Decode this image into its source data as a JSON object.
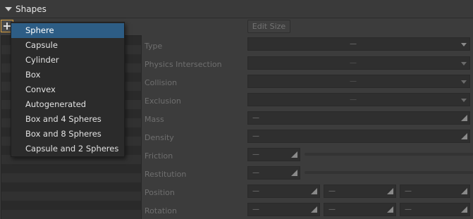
{
  "panel": {
    "title": "Shapes"
  },
  "toolbar": {
    "add_icon": "plus-icon",
    "edit_size_label": "Edit Size"
  },
  "menu": {
    "items": [
      {
        "label": "Sphere",
        "selected": true
      },
      {
        "label": "Capsule"
      },
      {
        "label": "Cylinder"
      },
      {
        "label": "Box"
      },
      {
        "label": "Convex"
      },
      {
        "label": "Autogenerated"
      },
      {
        "label": "Box and 4 Spheres"
      },
      {
        "label": "Box and 8 Spheres"
      },
      {
        "label": "Capsule and 2 Spheres"
      }
    ]
  },
  "properties": {
    "type": {
      "label": "Type",
      "value": "—"
    },
    "physics_intersection": {
      "label": "Physics Intersection",
      "value": "—"
    },
    "collision": {
      "label": "Collision",
      "value": "—"
    },
    "exclusion": {
      "label": "Exclusion",
      "value": "—"
    },
    "mass": {
      "label": "Mass",
      "value": "—"
    },
    "density": {
      "label": "Density",
      "value": "—"
    },
    "friction": {
      "label": "Friction",
      "value": "—"
    },
    "restitution": {
      "label": "Restitution",
      "value": "—"
    },
    "position": {
      "label": "Position",
      "x": "—",
      "y": "—",
      "z": "—"
    },
    "rotation": {
      "label": "Rotation",
      "x": "—",
      "y": "—",
      "z": "—"
    }
  },
  "colors": {
    "accent": "#2d5d85",
    "add_border": "#d8a040",
    "background": "#3c3c3c"
  }
}
